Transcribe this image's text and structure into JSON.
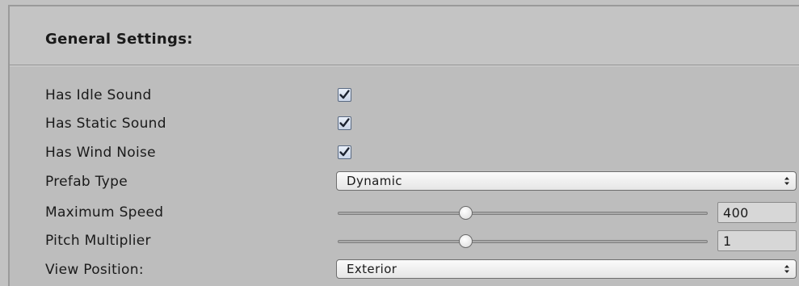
{
  "section": {
    "title": "General Settings:"
  },
  "fields": {
    "has_idle_sound": {
      "label": "Has Idle Sound",
      "checked": true
    },
    "has_static_sound": {
      "label": "Has Static Sound",
      "checked": true
    },
    "has_wind_noise": {
      "label": "Has Wind Noise",
      "checked": true
    },
    "prefab_type": {
      "label": "Prefab Type",
      "value": "Dynamic"
    },
    "maximum_speed": {
      "label": "Maximum Speed",
      "value": "400",
      "slider_fraction": 0.34
    },
    "pitch_multiplier": {
      "label": "Pitch Multiplier",
      "value": "1",
      "slider_fraction": 0.34
    },
    "view_position": {
      "label": "View Position:",
      "value": "Exterior"
    }
  },
  "icons": {
    "check": "checkmark-icon",
    "dropdown": "updown-arrow-icon"
  }
}
